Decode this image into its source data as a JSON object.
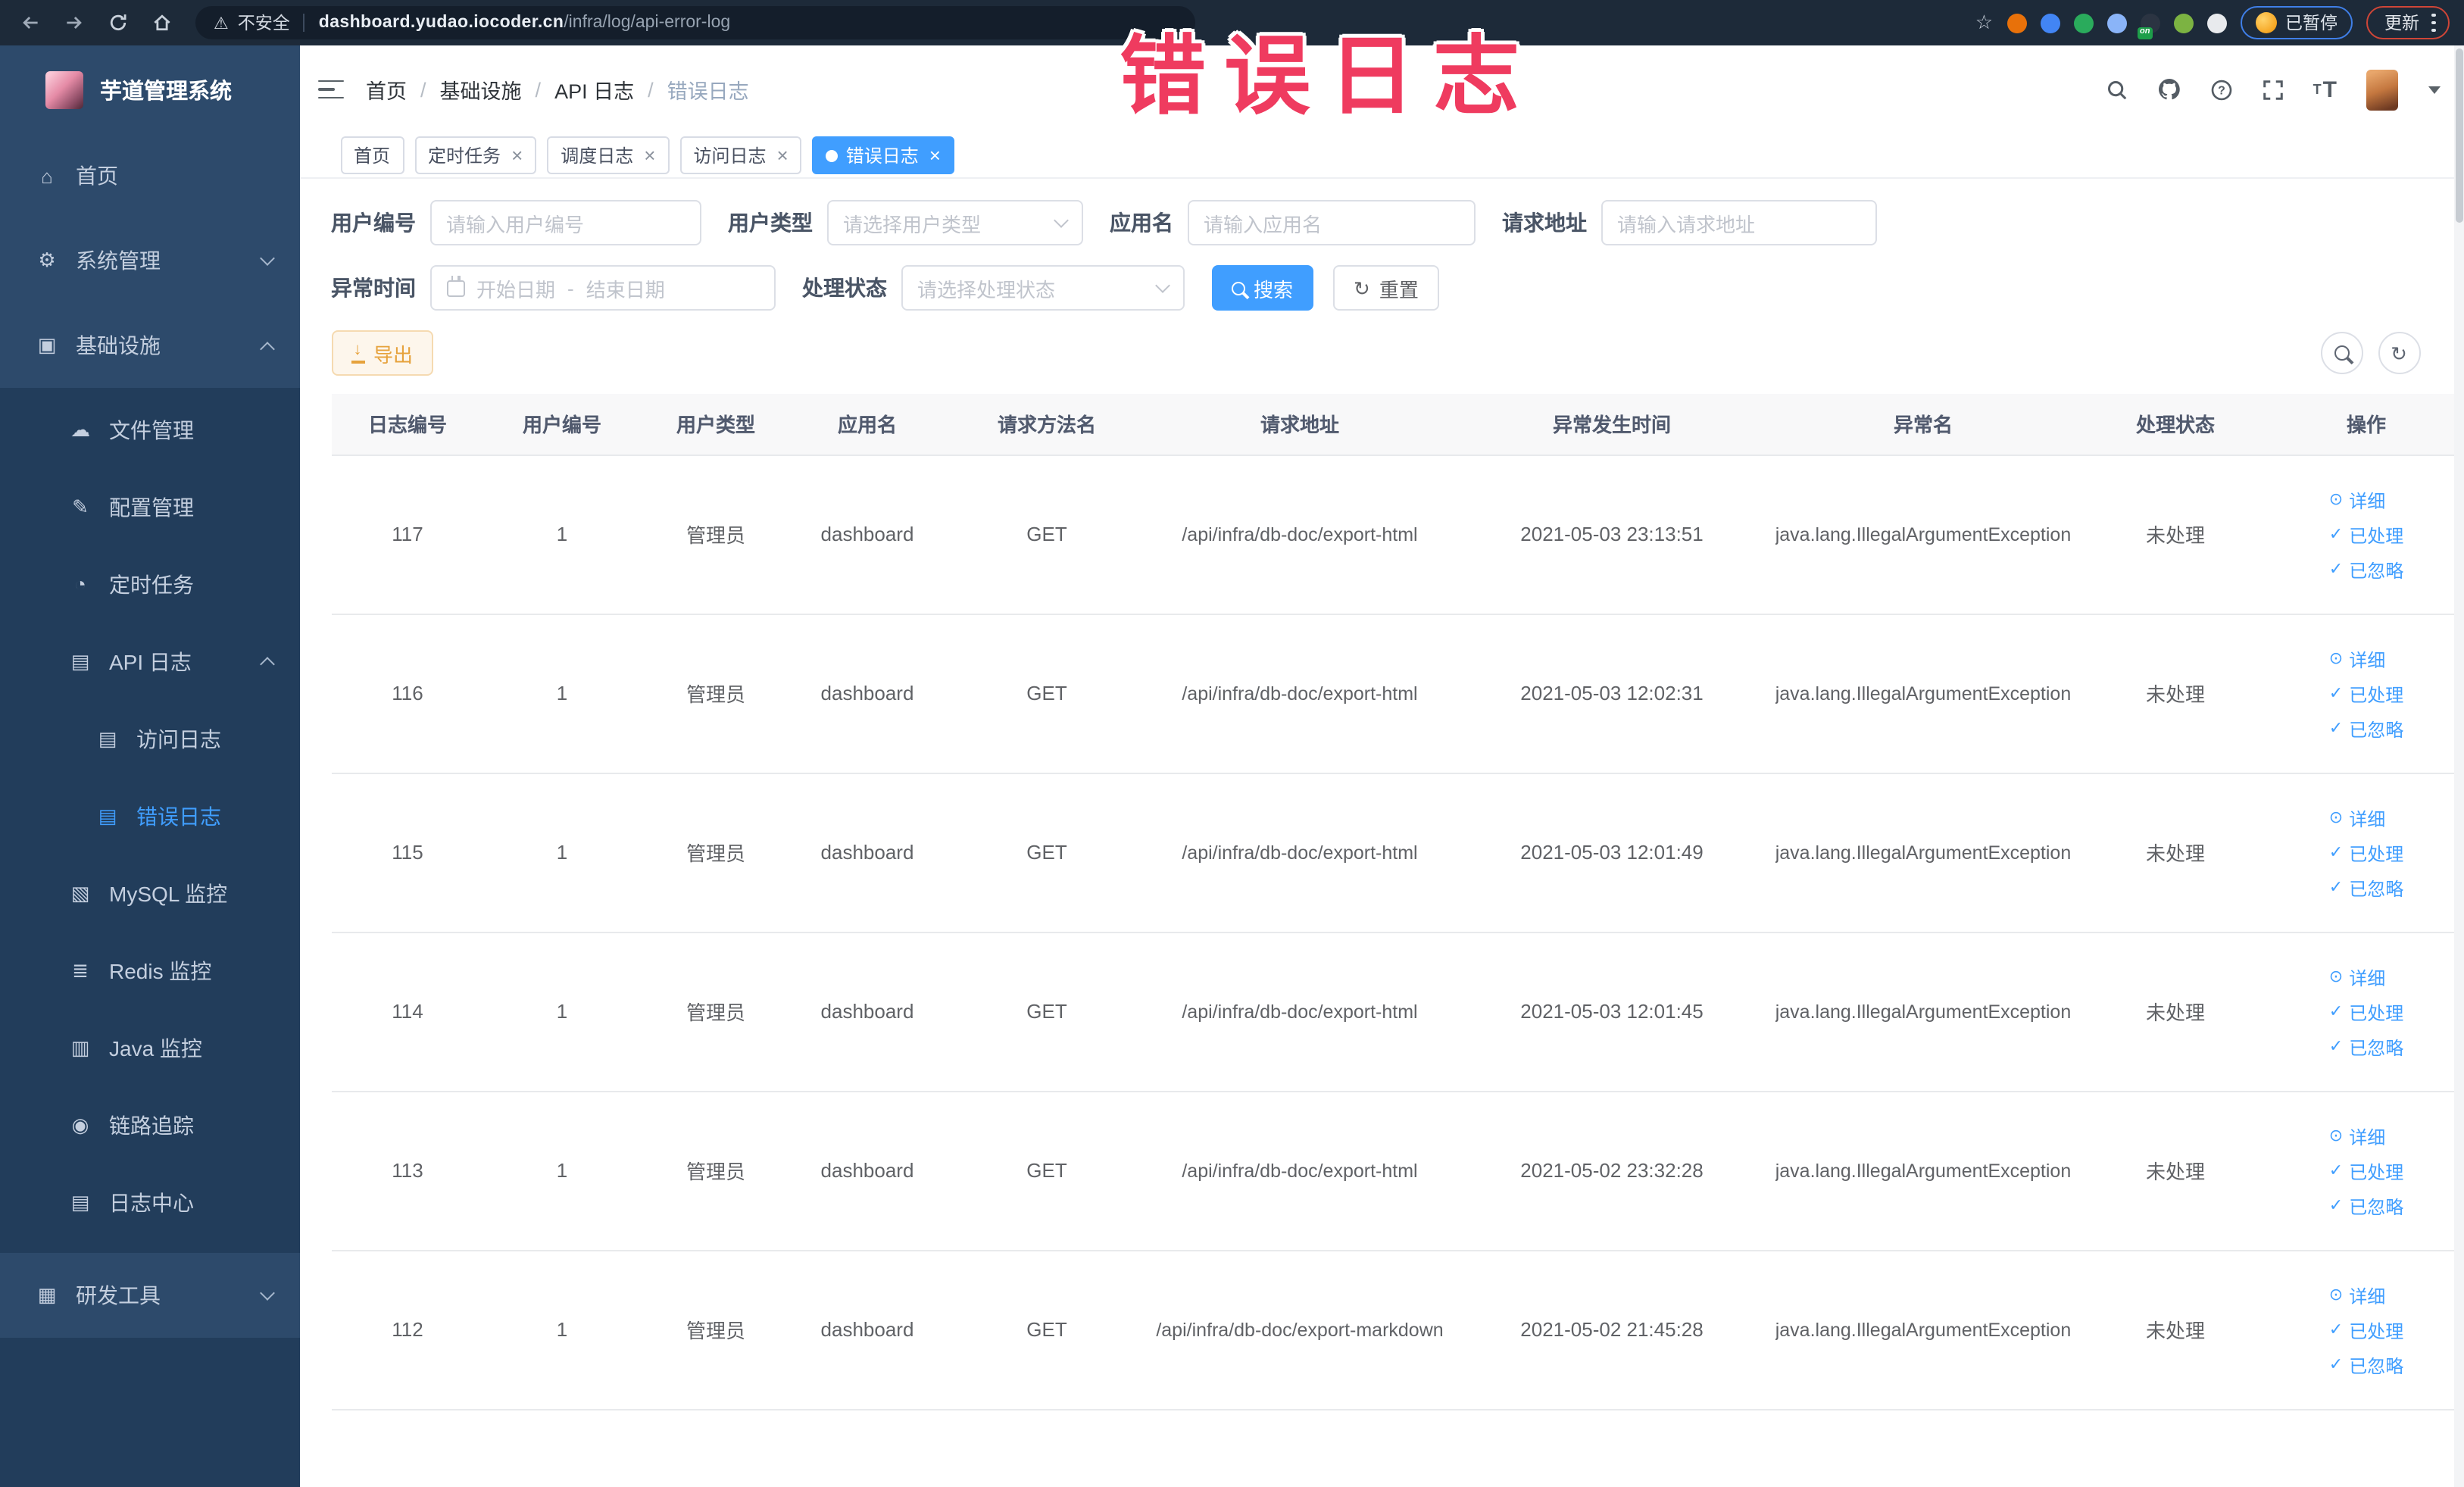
{
  "colors": {
    "accent": "#409eff",
    "warning": "#e6a23c",
    "annotation": "#ef3b5f",
    "sidebar_bg": "#2d4a6b",
    "sidebar_sub_bg": "#223d5b"
  },
  "icons": {
    "home": "⌂",
    "gear": "⚙",
    "monitor": "▣",
    "cloud-upload": "☁",
    "edit-square": "✎",
    "history": "◔",
    "log-edit": "▤",
    "chart": "▧",
    "stack": "≣",
    "java-monitor": "▥",
    "eye": "◉",
    "briefcase": "▦",
    "eye-small": "⊙",
    "check": "✓",
    "warning": "⚠",
    "star": "☆",
    "reload": "↻",
    "download": "↓"
  },
  "browser": {
    "security_text": "不安全",
    "url_domain": "dashboard.yudao.iocoder.cn",
    "url_path": "/infra/log/api-error-log",
    "paused_badge": "已暂停",
    "update_badge": "更新",
    "extensions": [
      {
        "name": "extension-orange",
        "color": "#e8710a"
      },
      {
        "name": "extension-blue-shield",
        "color": "#4285f4"
      },
      {
        "name": "extension-green-v",
        "color": "#2aab5c"
      },
      {
        "name": "extension-grid",
        "color": "#8ab4f8"
      },
      {
        "name": "extension-dark-on",
        "color": "#2b3442",
        "badge": "on"
      },
      {
        "name": "extension-plant",
        "color": "#7cb342"
      },
      {
        "name": "extension-puzzle",
        "color": "#e8eaed"
      }
    ]
  },
  "annotation": {
    "text": "错误日志"
  },
  "sidebar": {
    "app_title": "芋道管理系统",
    "items": [
      {
        "label": "首页",
        "icon": "home",
        "level": 1,
        "zone": "top"
      },
      {
        "label": "系统管理",
        "icon": "gear",
        "level": 1,
        "zone": "top",
        "chevron": "down"
      },
      {
        "label": "基础设施",
        "icon": "monitor",
        "level": 1,
        "zone": "top",
        "chevron": "up"
      },
      {
        "label": "文件管理",
        "icon": "cloud-upload",
        "level": 2,
        "zone": "sub"
      },
      {
        "label": "配置管理",
        "icon": "edit-square",
        "level": 2,
        "zone": "sub"
      },
      {
        "label": "定时任务",
        "icon": "history",
        "level": 2,
        "zone": "sub"
      },
      {
        "label": "API 日志",
        "icon": "log-edit",
        "level": 2,
        "zone": "sub",
        "chevron": "up"
      },
      {
        "label": "访问日志",
        "icon": "log-edit",
        "level": 3,
        "zone": "sub"
      },
      {
        "label": "错误日志",
        "icon": "log-edit",
        "level": 3,
        "zone": "sub",
        "active": true
      },
      {
        "label": "MySQL 监控",
        "icon": "chart",
        "level": 2,
        "zone": "sub"
      },
      {
        "label": "Redis 监控",
        "icon": "stack",
        "level": 2,
        "zone": "sub"
      },
      {
        "label": "Java 监控",
        "icon": "java-monitor",
        "level": 2,
        "zone": "sub"
      },
      {
        "label": "链路追踪",
        "icon": "eye",
        "level": 2,
        "zone": "sub"
      },
      {
        "label": "日志中心",
        "icon": "log-edit",
        "level": 2,
        "zone": "sub"
      },
      {
        "label": "研发工具",
        "icon": "briefcase",
        "level": 1,
        "zone": "tail",
        "chevron": "down"
      }
    ]
  },
  "header": {
    "breadcrumb": [
      "首页",
      "基础设施",
      "API 日志",
      "错误日志"
    ],
    "icons": [
      "search",
      "github",
      "help",
      "fullscreen",
      "font-size"
    ]
  },
  "tabs": [
    {
      "label": "首页",
      "closable": false,
      "active": false
    },
    {
      "label": "定时任务",
      "closable": true,
      "active": false
    },
    {
      "label": "调度日志",
      "closable": true,
      "active": false
    },
    {
      "label": "访问日志",
      "closable": true,
      "active": false
    },
    {
      "label": "错误日志",
      "closable": true,
      "active": true
    }
  ],
  "filters": {
    "user_id": {
      "label": "用户编号",
      "placeholder": "请输入用户编号"
    },
    "user_type": {
      "label": "用户类型",
      "placeholder": "请选择用户类型"
    },
    "app_name": {
      "label": "应用名",
      "placeholder": "请输入应用名"
    },
    "request_url": {
      "label": "请求地址",
      "placeholder": "请输入请求地址"
    },
    "exception_time": {
      "label": "异常时间",
      "start_placeholder": "开始日期",
      "separator": "-",
      "end_placeholder": "结束日期"
    },
    "process_status": {
      "label": "处理状态",
      "placeholder": "请选择处理状态"
    },
    "search_button": "搜索",
    "reset_button": "重置"
  },
  "toolbar": {
    "export_button": "导出"
  },
  "table": {
    "columns": [
      "日志编号",
      "用户编号",
      "用户类型",
      "应用名",
      "请求方法名",
      "请求地址",
      "异常发生时间",
      "异常名",
      "处理状态",
      "操作"
    ],
    "actions": [
      "详细",
      "已处理",
      "已忽略"
    ],
    "rows": [
      {
        "id": "117",
        "user_id": "1",
        "user_type": "管理员",
        "app_name": "dashboard",
        "method": "GET",
        "url": "/api/infra/db-doc/export-html",
        "time": "2021-05-03 23:13:51",
        "exception": "java.lang.IllegalArgumentException",
        "status": "未处理"
      },
      {
        "id": "116",
        "user_id": "1",
        "user_type": "管理员",
        "app_name": "dashboard",
        "method": "GET",
        "url": "/api/infra/db-doc/export-html",
        "time": "2021-05-03 12:02:31",
        "exception": "java.lang.IllegalArgumentException",
        "status": "未处理"
      },
      {
        "id": "115",
        "user_id": "1",
        "user_type": "管理员",
        "app_name": "dashboard",
        "method": "GET",
        "url": "/api/infra/db-doc/export-html",
        "time": "2021-05-03 12:01:49",
        "exception": "java.lang.IllegalArgumentException",
        "status": "未处理"
      },
      {
        "id": "114",
        "user_id": "1",
        "user_type": "管理员",
        "app_name": "dashboard",
        "method": "GET",
        "url": "/api/infra/db-doc/export-html",
        "time": "2021-05-03 12:01:45",
        "exception": "java.lang.IllegalArgumentException",
        "status": "未处理"
      },
      {
        "id": "113",
        "user_id": "1",
        "user_type": "管理员",
        "app_name": "dashboard",
        "method": "GET",
        "url": "/api/infra/db-doc/export-html",
        "time": "2021-05-02 23:32:28",
        "exception": "java.lang.IllegalArgumentException",
        "status": "未处理"
      },
      {
        "id": "112",
        "user_id": "1",
        "user_type": "管理员",
        "app_name": "dashboard",
        "method": "GET",
        "url": "/api/infra/db-doc/export-markdown",
        "time": "2021-05-02 21:45:28",
        "exception": "java.lang.IllegalArgumentException",
        "status": "未处理"
      }
    ]
  }
}
